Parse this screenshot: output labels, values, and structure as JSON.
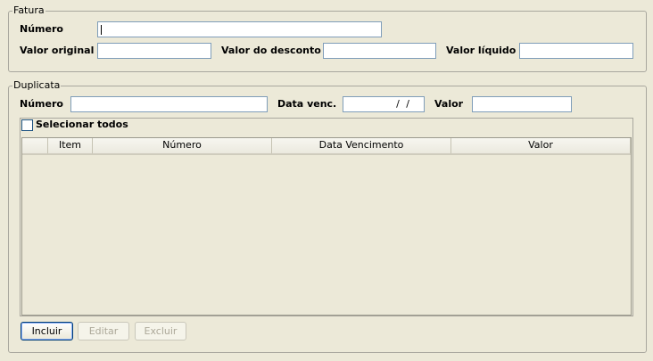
{
  "fatura": {
    "title": "Fatura",
    "numero_label": "Número",
    "numero_value": "",
    "valor_original_label": "Valor original",
    "valor_original_value": "",
    "valor_desconto_label": "Valor do desconto",
    "valor_desconto_value": "",
    "valor_liquido_label": "Valor líquido",
    "valor_liquido_value": ""
  },
  "duplicata": {
    "title": "Duplicata",
    "numero_label": "Número",
    "numero_value": "",
    "data_venc_label": "Data venc.",
    "data_venc_mask": "/ /",
    "valor_label": "Valor",
    "valor_value": "",
    "select_all_label": "Selecionar todos",
    "select_all_checked": false,
    "table": {
      "columns": [
        "",
        "Item",
        "Número",
        "Data Vencimento",
        "Valor"
      ],
      "rows": []
    },
    "buttons": {
      "incluir": "Incluir",
      "editar": "Editar",
      "excluir": "Excluir"
    }
  },
  "colors": {
    "background": "#ece9d8",
    "field_border": "#7f9db9",
    "button_focus_border": "#003c74",
    "disabled_text": "#aca899"
  }
}
